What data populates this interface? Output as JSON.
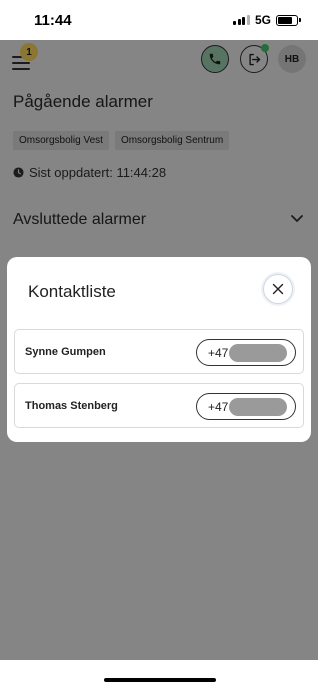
{
  "status_bar": {
    "time": "11:44",
    "network": "5G"
  },
  "header": {
    "notification_count": "1",
    "avatar_initials": "HB"
  },
  "ongoing": {
    "title": "Pågående alarmer",
    "tags": [
      "Omsorgsbolig Vest",
      "Omsorgsbolig Sentrum"
    ],
    "last_updated": "Sist oppdatert: 11:44:28"
  },
  "finished": {
    "title": "Avsluttede alarmer"
  },
  "modal": {
    "title": "Kontaktliste",
    "contacts": [
      {
        "name": "Synne Gumpen",
        "phone_prefix": "+47"
      },
      {
        "name": "Thomas Stenberg",
        "phone_prefix": "+47"
      }
    ]
  },
  "colors": {
    "call_button": "#9fd3b3",
    "badge": "#ffd75e",
    "online": "#43c96a",
    "overlay": "rgba(0,0,0,0.45)"
  }
}
